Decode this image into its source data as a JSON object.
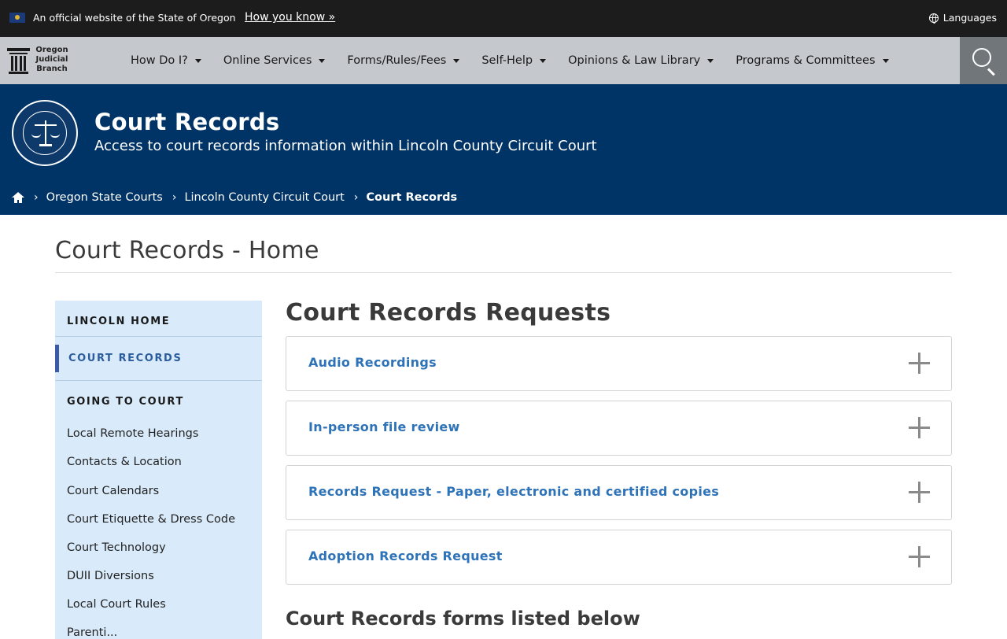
{
  "gov_banner": {
    "official_text": "An official website of the State of Oregon",
    "how_link": "How you know »",
    "languages": "Languages"
  },
  "logo": {
    "line1": "Oregon",
    "line2": "Judicial",
    "line3": "Branch"
  },
  "nav": {
    "items": [
      {
        "label": "How Do I?"
      },
      {
        "label": "Online Services"
      },
      {
        "label": "Forms/Rules/Fees"
      },
      {
        "label": "Self-Help"
      },
      {
        "label": "Opinions & Law Library"
      },
      {
        "label": "Programs & Committees"
      }
    ]
  },
  "hero": {
    "title": "Court Records",
    "subtitle": "Access to court records information within Lincoln County Circuit Court"
  },
  "breadcrumb": {
    "items": [
      "Oregon State Courts",
      "Lincoln County Circuit Court"
    ],
    "current": "Court Records"
  },
  "page": {
    "title": "Court Records - Home"
  },
  "sidebar": {
    "home": "LINCOLN HOME",
    "active": "COURT RECORDS",
    "section": "GOING TO COURT",
    "links": [
      "Local Remote Hearings",
      "Contacts & Location",
      "Court Calendars",
      "Court Etiquette & Dress Code",
      "Court Technology",
      "DUII Diversions",
      "Local Court Rules",
      "Parenti..."
    ]
  },
  "main": {
    "heading": "Court Records Requests",
    "accordions": [
      "Audio Recordings",
      "In-person file review",
      "Records Request - Paper, electronic and certified copies",
      "Adoption Records Request"
    ],
    "forms_heading": "Court Records forms listed below"
  },
  "colors": {
    "banner": "#1c1c1c",
    "navbar": "#c5c8cc",
    "hero": "#003366",
    "sidebar": "#d9ebfb",
    "link": "#2e73b8"
  }
}
